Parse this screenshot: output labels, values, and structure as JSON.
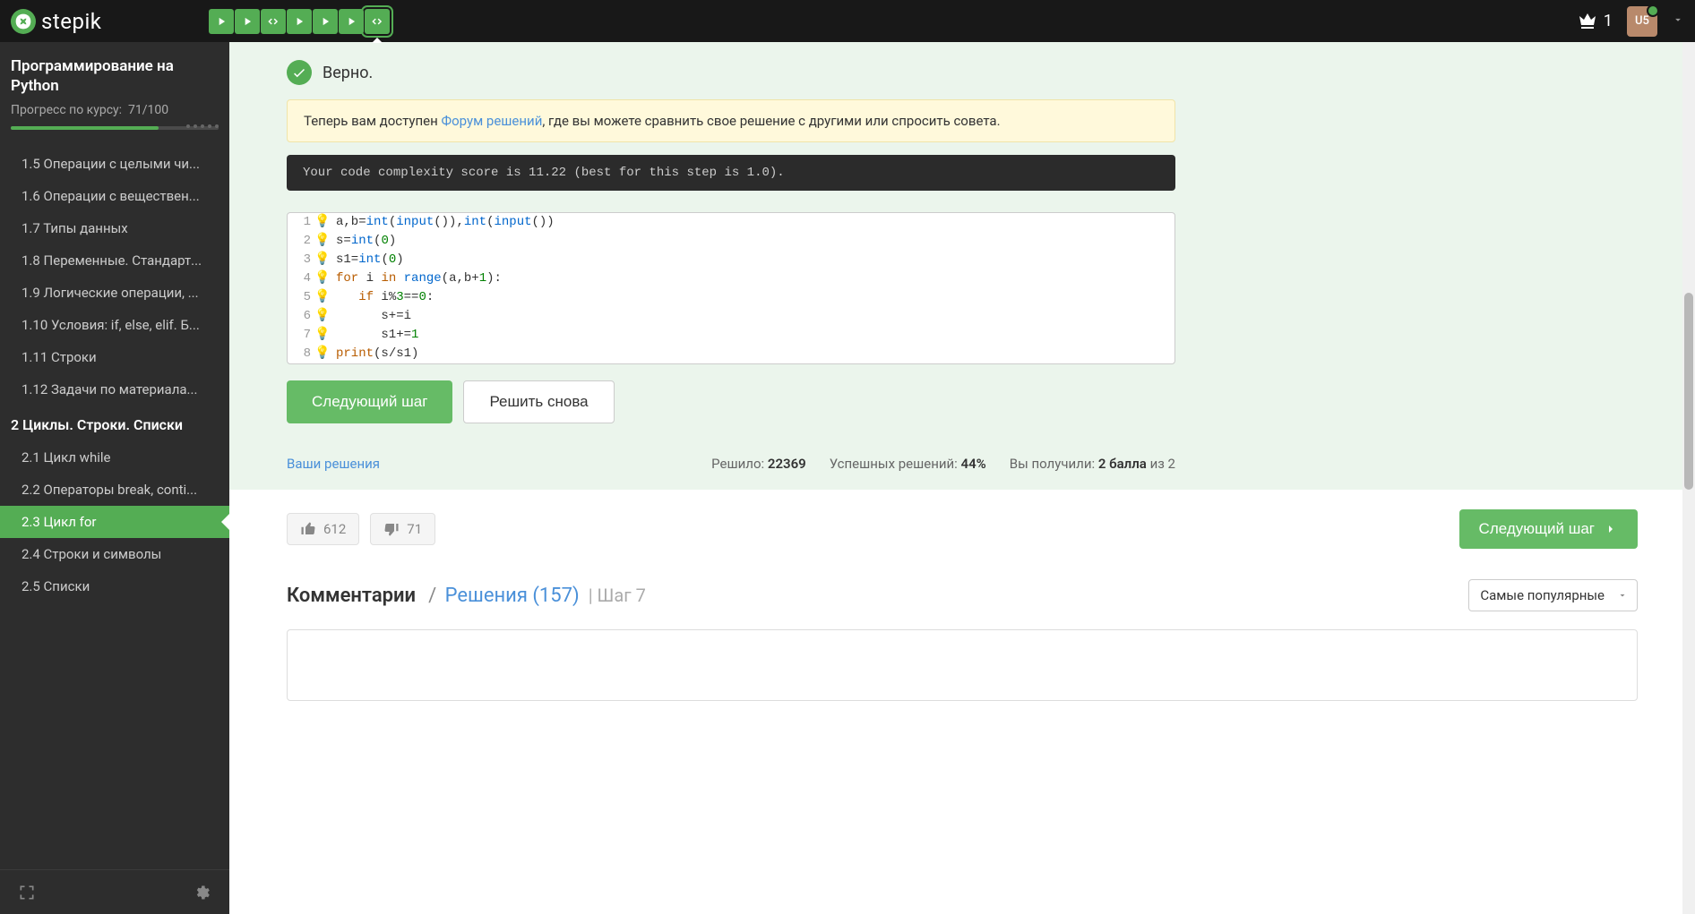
{
  "header": {
    "logo_text": "stepik",
    "crown_count": "1",
    "user_initials": "U5"
  },
  "steps_nav": {
    "count": 7,
    "types": [
      "play",
      "play",
      "code",
      "play",
      "play",
      "play",
      "code"
    ],
    "active_index": 6
  },
  "sidebar": {
    "course_title": "Программирование на Python",
    "progress_label": "Прогресс по курсу:",
    "progress_value": "71/100",
    "progress_percent": 71,
    "items": [
      {
        "type": "item",
        "label": "1.5  Операции с целыми чи..."
      },
      {
        "type": "item",
        "label": "1.6  Операции с веществен..."
      },
      {
        "type": "item",
        "label": "1.7  Типы данных"
      },
      {
        "type": "item",
        "label": "1.8  Переменные. Стандарт..."
      },
      {
        "type": "item",
        "label": "1.9  Логические операции, ..."
      },
      {
        "type": "item",
        "label": "1.10  Условия: if, else, elif. Б..."
      },
      {
        "type": "item",
        "label": "1.11  Строки"
      },
      {
        "type": "item",
        "label": "1.12  Задачи по материала..."
      },
      {
        "type": "section",
        "label": "2  Циклы. Строки. Списки"
      },
      {
        "type": "item",
        "label": "2.1  Цикл while"
      },
      {
        "type": "item",
        "label": "2.2  Операторы break, conti..."
      },
      {
        "type": "item",
        "label": "2.3  Цикл for",
        "active": true
      },
      {
        "type": "item",
        "label": "2.4  Строки и символы"
      },
      {
        "type": "item",
        "label": "2.5  Списки"
      }
    ]
  },
  "result": {
    "correct_label": "Верно.",
    "forum_prefix": "Теперь вам доступен ",
    "forum_link": "Форум решений",
    "forum_suffix": ", где вы можете сравнить свое решение с другими или спросить совета.",
    "complexity": "Your code complexity score is 11.22 (best for this step is 1.0)."
  },
  "code_lines": [
    "a,b=int(input()),int(input())",
    "s=int(0)",
    "s1=int(0)",
    "for i in range(a,b+1):",
    "   if i%3==0:",
    "      s+=i",
    "      s1+=1",
    "print(s/s1)"
  ],
  "buttons": {
    "next": "Следующий шаг",
    "retry": "Решить снова"
  },
  "stats": {
    "solutions_link": "Ваши решения",
    "solved_label": "Решило: ",
    "solved_value": "22369",
    "success_label": "Успешных решений: ",
    "success_value": "44%",
    "points_label": "Вы получили: ",
    "points_value": "2 балла",
    "points_suffix": " из 2"
  },
  "footer": {
    "like_count": "612",
    "dislike_count": "71",
    "next_step": "Следующий шаг",
    "comments_label": "Комментарии",
    "solutions_tab": "Решения (157)",
    "step_label": "| Шаг 7",
    "sort_label": "Самые популярные"
  }
}
